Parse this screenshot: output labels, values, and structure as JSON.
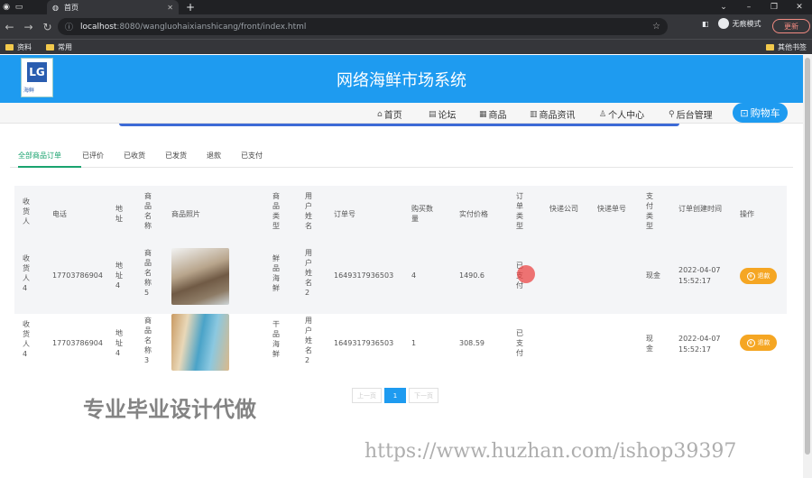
{
  "browser": {
    "tab_title": "首页",
    "url_host": "localhost",
    "url_rest": ":8080/wangluohaixianshicang/front/index.html",
    "incognito_label": "无痕模式",
    "update_label": "更新",
    "bookmarks": [
      "资料",
      "常用"
    ],
    "other_bookmarks": "其他书签"
  },
  "site": {
    "title": "网络海鲜市场系统",
    "logo_text": "LG",
    "logo_sub": "海鲜"
  },
  "nav": {
    "items": [
      "首页",
      "论坛",
      "商品",
      "商品资讯",
      "个人中心",
      "后台管理"
    ],
    "cart": "购物车"
  },
  "order_tabs": [
    "全部商品订单",
    "已评价",
    "已收货",
    "已发货",
    "退款",
    "已支付"
  ],
  "table": {
    "headers": [
      "收货人",
      "电话",
      "地址",
      "商品名称",
      "商品照片",
      "商品类型",
      "用户姓名",
      "订单号",
      "购买数量",
      "实付价格",
      "订单类型",
      "快递公司",
      "快递单号",
      "支付类型",
      "订单创建时间",
      "操作"
    ],
    "rows": [
      {
        "receiver": "收货人4",
        "phone": "17703786904",
        "address": "地址4",
        "product": "商品名称5",
        "type": "鲜品海鲜",
        "user": "用户姓名2",
        "order_no": "1649317936503",
        "qty": "4",
        "price": "1490.6",
        "status": "已支付",
        "pay": "现金",
        "created_date": "2022-04-07",
        "created_time": "15:52:17",
        "action": "退款"
      },
      {
        "receiver": "收货人4",
        "phone": "17703786904",
        "address": "地址4",
        "product": "商品名称3",
        "type": "干品海鲜",
        "user": "用户姓名2",
        "order_no": "1649317936503",
        "qty": "1",
        "price": "308.59",
        "status": "已支付",
        "pay": "现金",
        "created_date": "2022-04-07",
        "created_time": "15:52:17",
        "action": "退款"
      }
    ]
  },
  "pager": {
    "prev": "上一页",
    "current": "1",
    "next": "下一页"
  },
  "watermarks": {
    "ad": "专业毕业设计代做",
    "url": "https://www.huzhan.com/ishop39397"
  }
}
